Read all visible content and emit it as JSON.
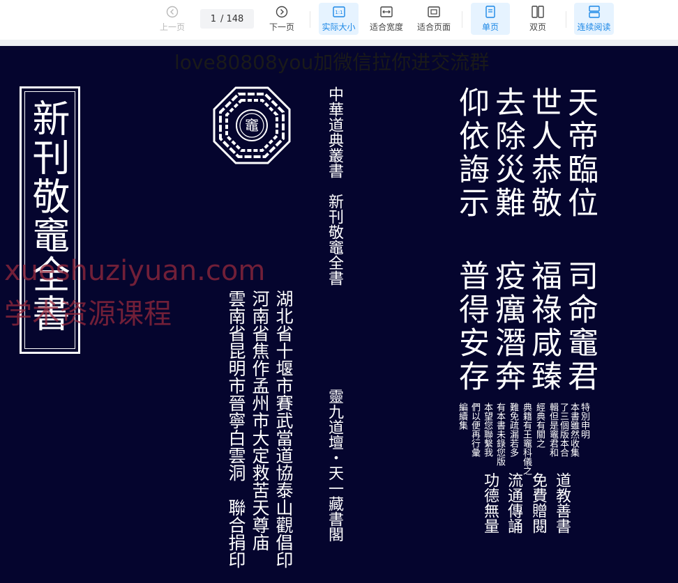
{
  "toolbar": {
    "prev_label": "上一页",
    "page_current": "1",
    "page_total": "/ 148",
    "next_label": "下一页",
    "actual_size_label": "实际大小",
    "fit_width_label": "适合宽度",
    "fit_page_label": "适合页面",
    "single_page_label": "单页",
    "double_page_label": "双页",
    "continuous_label": "连续阅读"
  },
  "page": {
    "watermark_top": "love80808you加微信拉你进交流群",
    "watermark_site": "xueshuziyuan.com",
    "watermark_name": "学术资源课程",
    "book_title": "新刊敬竈全書",
    "series_line": "中華道典叢書　新刊敬竈全書",
    "publisher_line": "靈九道壇・天一藏書閣",
    "temple_1": "湖北省十堰市賽武當道協泰山觀倡印",
    "temple_2": "河南省焦作孟州市大定救苦天尊庙",
    "temple_3": "雲南省昆明市晉寧白雲洞　聯合捐印",
    "verse_col_1": "天帝臨位",
    "verse_col_2": "世人恭敬",
    "verse_col_3": "去除災難",
    "verse_col_4": "仰依誨示",
    "verse_col_5": "司命竈君",
    "verse_col_6": "福祿咸臻",
    "verse_col_7": "疫癘潛奔",
    "verse_col_8": "普得安存",
    "note_col_1": "特別申明",
    "note_col_2": "本書雖然收集",
    "note_col_3": "了三個版本合",
    "note_col_4": "輯但是竈君和",
    "note_col_5": "經典有關之",
    "note_col_6": "典籍有王竈科儀之",
    "note_col_7": "難免疏漏若多",
    "note_col_8": "有本書未錄您版",
    "note_col_9": "本望您聯繫我",
    "note_col_10": "們以便再行彙",
    "note_col_11": "編續集",
    "free_col_1": "道教善書",
    "free_col_2": "免費贈閱",
    "free_col_3": "流通傳誦",
    "free_col_4": "功德無量",
    "bagua_seal_char": "竈"
  },
  "colors": {
    "page_background": "#05052e",
    "accent": "#1b87e6",
    "active_button_bg": "#e6f3ff"
  }
}
